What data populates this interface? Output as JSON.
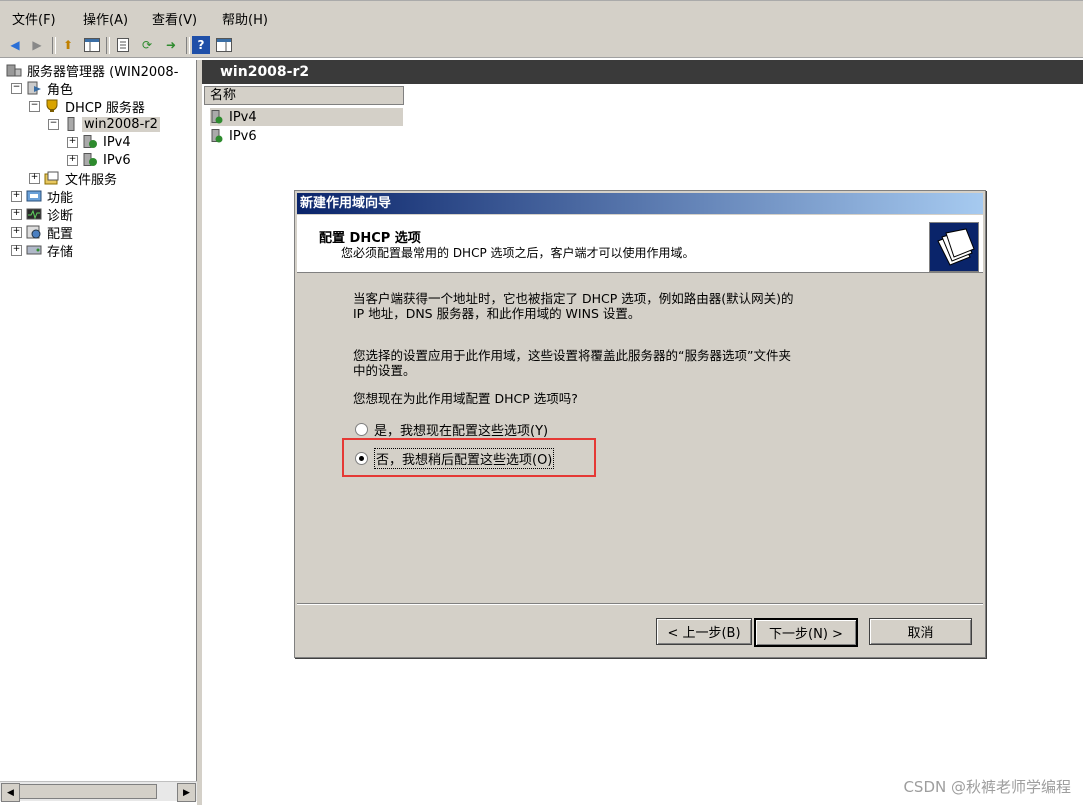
{
  "menu": [
    "文件(F)",
    "操作(A)",
    "查看(V)",
    "帮助(H)"
  ],
  "toolbar": {
    "icons": [
      "back-icon",
      "forward-icon",
      "up-icon",
      "show-hide-tree-icon",
      "properties-icon",
      "refresh-icon",
      "export-icon",
      "help-icon",
      "show-hide-action-icon"
    ]
  },
  "tree": {
    "root": "服务器管理器 (WIN2008-",
    "roles": "角色",
    "dhcp": "DHCP 服务器",
    "server": "win2008-r2",
    "ipv4": "IPv4",
    "ipv6": "IPv6",
    "file_services": "文件服务",
    "features": "功能",
    "diagnostics": "诊断",
    "configuration": "配置",
    "storage": "存储"
  },
  "right": {
    "header": "win2008-r2",
    "column": "名称",
    "rows": [
      "IPv4",
      "IPv6"
    ]
  },
  "dialog": {
    "title": "新建作用域向导",
    "heading": "配置 DHCP 选项",
    "subheading": "您必须配置最常用的 DHCP 选项之后，客户端才可以使用作用域。",
    "para1_line1": "当客户端获得一个地址时，它也被指定了 DHCP 选项，例如路由器(默认网关)的",
    "para1_line2": "IP 地址，DNS 服务器，和此作用域的 WINS 设置。",
    "para2_line1": "您选择的设置应用于此作用域，这些设置将覆盖此服务器的“服务器选项”文件夹",
    "para2_line2": "中的设置。",
    "question": "您想现在为此作用域配置 DHCP 选项吗?",
    "option_yes": "是，我想现在配置这些选项(Y)",
    "option_no": "否，我想稍后配置这些选项(O)",
    "selected": "option_no",
    "back": "< 上一步(B)",
    "next": "下一步(N) >",
    "cancel": "取消"
  },
  "watermark": "CSDN @秋裤老师学编程",
  "colors": {
    "highlight": "#e53935",
    "title_start": "#0a246a",
    "title_end": "#a6caf0"
  }
}
